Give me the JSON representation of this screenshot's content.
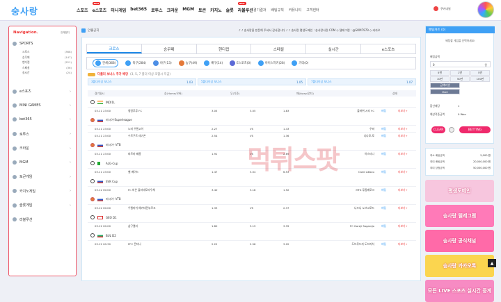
{
  "header": {
    "logo": "숭사랑",
    "nav": [
      {
        "label": "스포츠",
        "badge": ""
      },
      {
        "label": "e스포츠",
        "badge": "NEW"
      },
      {
        "label": "미니게임",
        "badge": ""
      },
      {
        "label": "bet365",
        "badge": ""
      },
      {
        "label": "로투스",
        "badge": ""
      },
      {
        "label": "크라운",
        "badge": ""
      },
      {
        "label": "MGM",
        "badge": ""
      },
      {
        "label": "토큰",
        "badge": ""
      },
      {
        "label": "카지노",
        "badge": ""
      },
      {
        "label": "슬롯",
        "badge": ""
      },
      {
        "label": "라볼루션",
        "badge": "NEW"
      }
    ],
    "nav2": [
      "경기결과",
      "배팅규칙",
      "커뮤니티",
      "고객센터"
    ],
    "user_label": "쿠키네빌"
  },
  "sidebar": {
    "title": "Navigation.",
    "link": "전체펼치",
    "sports_label": "SPORTS",
    "sports_items": [
      {
        "label": "크로스",
        "count": "(368)"
      },
      {
        "label": "승무패",
        "count": "(147)"
      },
      {
        "label": "핸디캡",
        "count": "(221)"
      },
      {
        "label": "스페셜",
        "count": "(36)"
      },
      {
        "label": "실시간",
        "count": "(24)"
      }
    ],
    "sections": [
      "e스포츠",
      "MINI GAMES",
      "bet365",
      "로투스",
      "크라운",
      "MGM",
      "토큰게임",
      "카지노게임",
      "슬롯게임",
      "라볼루션"
    ]
  },
  "main": {
    "notice_label": "안좋공지",
    "marquee": "♪ ♪ 숭사랑을 방문해 주셔서 감사합니다 ♪ ♪ 숭사랑 평생도메인 : 숭사랑사랑.COM ◇ 텔레그램 : @SOM7979 ◇ 카카오",
    "tabs": [
      "크로스",
      "승무패",
      "핸디캡",
      "스페셜",
      "실시간",
      "e스포츠"
    ],
    "sports": [
      {
        "label": "전체(368)"
      },
      {
        "label": "축구(284)"
      },
      {
        "label": "야구(13)"
      },
      {
        "label": "농구(49)"
      },
      {
        "label": "배구(14)"
      },
      {
        "label": "E스포츠(0)"
      },
      {
        "label": "아이스하키(28)"
      },
      {
        "label": "기타(0)"
      }
    ],
    "bonus_title": "다폴더 보너스 추가 배당",
    "bonus_note": "(3, 5, 7 폴더 이상 조합시 지급)",
    "bonus": [
      {
        "name": "3폴더이상 보너스",
        "value": "1.03"
      },
      {
        "name": "5폴더이상 보너스",
        "value": "1.05"
      },
      {
        "name": "7폴더이상 보너스",
        "value": "1.07"
      }
    ],
    "thead": {
      "time": "경기일시",
      "home": "승(Home/오버)",
      "draw": "무(기준)",
      "away": "패(Away/언더)",
      "status": "상태"
    },
    "leagues": [
      {
        "name": "INDI1L",
        "flag": "in",
        "ball": "soccer",
        "rows": [
          {
            "time": "03.11 23:00",
            "home": "벵갈루루 FC",
            "ho": "3.05",
            "draw": "3.05",
            "ao": "1.83",
            "away": "몰바위 시티 FC",
            "status": "배팅",
            "more": "더보기+"
          }
        ]
      },
      {
        "name": "러시아-Superleague",
        "flag": "ru",
        "ball": "basketball",
        "rows": [
          {
            "time": "03.11 23:00",
            "home": "노비 우렌고이",
            "ho": "2.27",
            "draw": "VS",
            "ao": "1.43",
            "away": "우파",
            "status": "배팅",
            "more": "더보기+"
          },
          {
            "time": "03.11 23:00",
            "home": "수르구트 레기온",
            "ho": "2.54",
            "draw": "VS",
            "ao": "1.36",
            "away": "디나모-로",
            "status": "배팅",
            "more": "더보기+"
          }
        ]
      },
      {
        "name": "러시아- VTB",
        "flag": "ru",
        "ball": "basketball",
        "rows": [
          {
            "time": "03.11 23:00",
            "home": "파르마 페름",
            "ho": "1.91",
            "draw": "VS",
            "ao": "2.69",
            "away": "아스타나",
            "status": "배팅",
            "more": "더보기+"
          }
        ]
      },
      {
        "name": "ALG-Cup",
        "flag": "dz",
        "ball": "soccer",
        "rows": [
          {
            "time": "03.11 23:00",
            "home": "벨 베이드",
            "ho": "1.47",
            "draw": "3.04",
            "ao": "6.53",
            "away": "Oued Akbou",
            "status": "배팅",
            "more": "더보기+"
          }
        ]
      },
      {
        "name": "SVK Cup",
        "flag": "ru",
        "ball": "soccer",
        "rows": [
          {
            "time": "03.12 00:00",
            "home": "FC 비온 즐라테모라우체",
            "ho": "3.40",
            "draw": "3.18",
            "ao": "1.92",
            "away": "MFK 루좀베로크",
            "status": "배팅",
            "more": "더보기+"
          }
        ]
      },
      {
        "name": "러시아- VTB",
        "flag": "ru",
        "ball": "basketball",
        "rows": [
          {
            "time": "03.12 00:00",
            "home": "우렐마쉬 예카테린부르크",
            "ho": "1.33",
            "draw": "VS",
            "ao": "2.37",
            "away": "니즈니 노브고로드",
            "status": "배팅",
            "more": "더보기+"
          }
        ]
      },
      {
        "name": "GEO D1",
        "flag": "ge",
        "ball": "soccer",
        "rows": [
          {
            "time": "03.12 00:00",
            "home": "삼구렐리",
            "ho": "1.80",
            "draw": "3.19",
            "ao": "3.39",
            "away": "FC Gareji Sagarejo",
            "status": "배팅",
            "more": "더보기+"
          }
        ]
      },
      {
        "name": "BUL D2",
        "flag": "bg",
        "ball": "soccer",
        "rows": [
          {
            "time": "03.12 00:30",
            "home": "PFC 몬타나",
            "ho": "2.22",
            "draw": "2.58",
            "ao": "3.02",
            "away": "도브루드자 도브리치",
            "status": "배팅",
            "more": "더보기+"
          }
        ]
      }
    ],
    "watermark": "먹튀스팟"
  },
  "slip": {
    "header": "배팅카트 (0)",
    "title": "배팅할 게임을 선택하세요!",
    "amount_label": "배팅금액",
    "amount": "0",
    "unit": "원",
    "chips": [
      "5천",
      "1만",
      "5만",
      "10만",
      "50만",
      "100만",
      "금액리셋",
      "MAX"
    ],
    "odds_label": "합산배당",
    "odds": "1",
    "expect_label": "예상적중금액",
    "expect": "0 Won",
    "clear": "CLEAR",
    "betting": "BETTING"
  },
  "info": [
    {
      "k": "최소 배팅금액",
      "v": "5,000 원"
    },
    {
      "k": "최대 배팅금액",
      "v": "20,000,000 원"
    },
    {
      "k": "최대 당첨금액",
      "v": "50,000,000 원"
    }
  ],
  "banners": [
    {
      "text": "평생도메인",
      "bg": "#f7c6de"
    },
    {
      "text": "숭사랑 텔레그램",
      "bg": "#ff7ab8"
    },
    {
      "text": "숭사랑 공식채널",
      "bg": "#ff6aa8"
    },
    {
      "text": "숭사랑 카카오톡",
      "bg": "#fbd54f"
    },
    {
      "text": "모든 LIVE 스포츠 실시간 중계",
      "bg": "#f78bc3"
    }
  ]
}
